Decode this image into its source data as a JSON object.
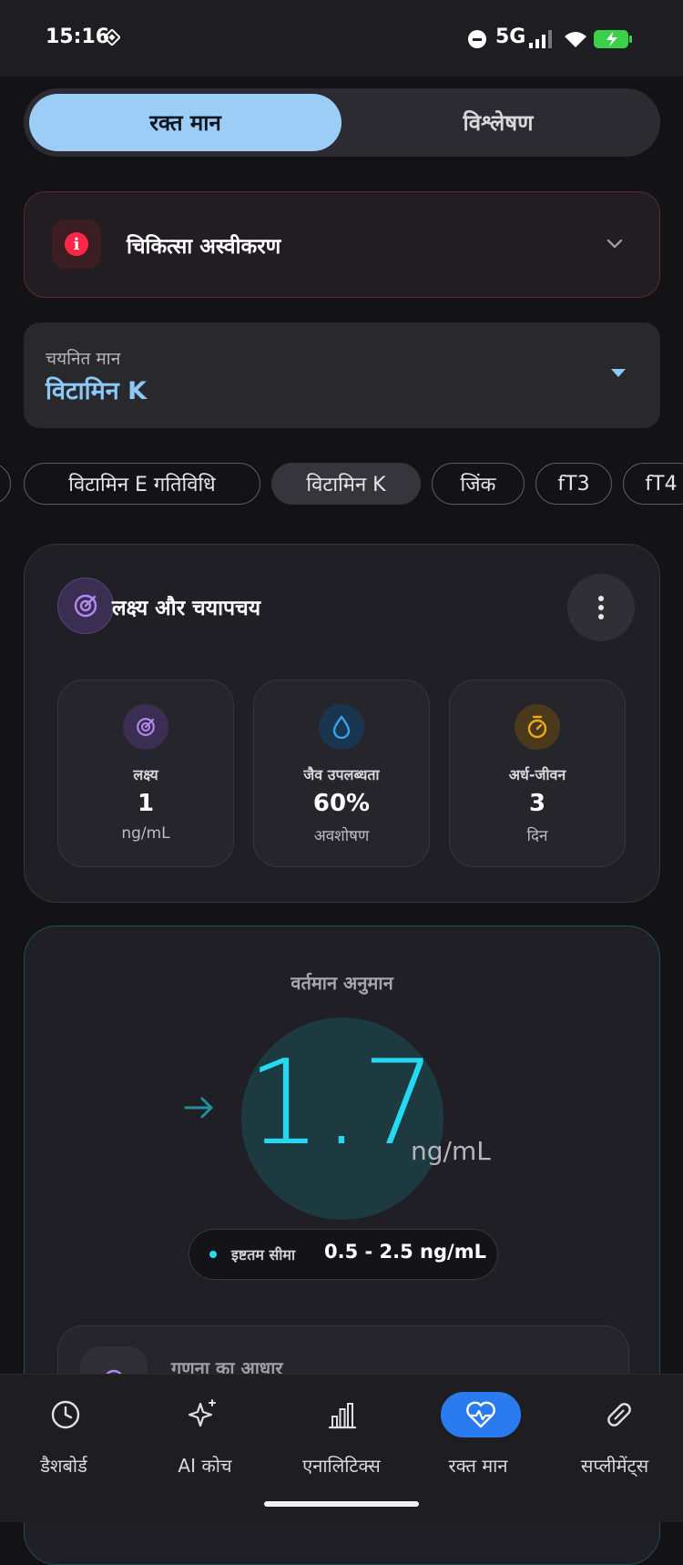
{
  "status_bar": {
    "time": "15:16",
    "network": "5G"
  },
  "tabs": {
    "active": "रक्त मान",
    "inactive": "विश्लेषण"
  },
  "disclaimer": {
    "title": "चिकित्सा अस्वीकरण",
    "icon": "i"
  },
  "selector": {
    "label": "चयनित मान",
    "value": "विटामिन K"
  },
  "chips": [
    "विटामिन E गतिविधि",
    "विटामिन K",
    "जिंक",
    "fT3",
    "fT4"
  ],
  "goals_card": {
    "title": "लक्ष्य और चयापचय",
    "metrics": [
      {
        "label": "लक्ष्य",
        "value": "1",
        "unit": "ng/mL",
        "icon": "target-icon",
        "color": "#b58af0"
      },
      {
        "label": "जैव उपलब्धता",
        "value": "60%",
        "unit": "अवशोषण",
        "icon": "drop-icon",
        "color": "#3aa0f0"
      },
      {
        "label": "अर्ध-जीवन",
        "value": "3",
        "unit": "दिन",
        "icon": "stopwatch-icon",
        "color": "#f0a81c"
      }
    ]
  },
  "estimate_card": {
    "label": "वर्तमान अनुमान",
    "value": "1.7",
    "unit": "ng/mL",
    "range_label": "इष्टतम सीमा",
    "range_value": "0.5 - 2.5 ng/mL",
    "basis_title": "गणना का आधार"
  },
  "bottom_nav": [
    {
      "label": "डैशबोर्ड",
      "icon": "clock-icon"
    },
    {
      "label": "AI कोच",
      "icon": "sparkle-icon"
    },
    {
      "label": "एनालिटिक्स",
      "icon": "bar-chart-icon"
    },
    {
      "label": "रक्त मान",
      "icon": "heart-pulse-icon",
      "active": true
    },
    {
      "label": "सप्लीमेंट्स",
      "icon": "pill-icon"
    }
  ],
  "colors": {
    "accent_blue": "#9ccdf6",
    "cyan": "#25d9f2",
    "nav_active": "#2a7bf0",
    "alert_red": "#ff2648"
  }
}
